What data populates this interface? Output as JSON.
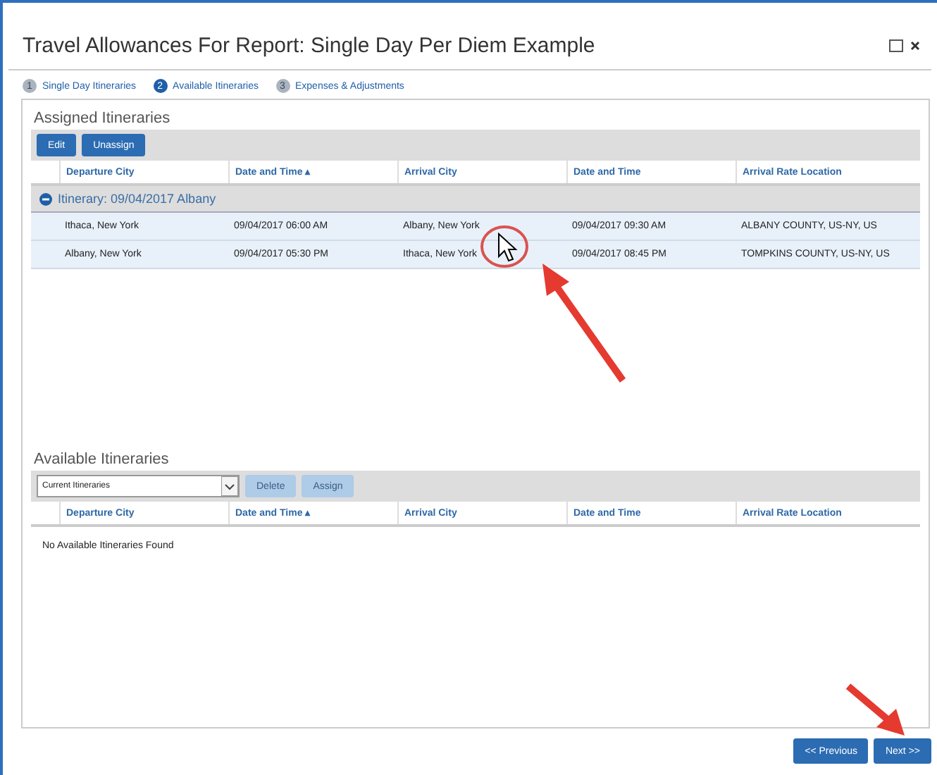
{
  "window": {
    "title": "Travel Allowances For Report: Single Day Per Diem Example"
  },
  "steps": [
    {
      "number": "1",
      "label": "Single Day Itineraries",
      "selected": false
    },
    {
      "number": "2",
      "label": "Available Itineraries",
      "selected": true
    },
    {
      "number": "3",
      "label": "Expenses & Adjustments",
      "selected": false
    }
  ],
  "assigned": {
    "title": "Assigned Itineraries",
    "buttons": [
      {
        "label": "Edit",
        "disabled": false
      },
      {
        "label": "Unassign",
        "disabled": false
      }
    ],
    "columns": [
      "Departure City",
      "Date and Time ▴",
      "Arrival City",
      "Date and Time",
      "Arrival Rate Location"
    ],
    "groups": [
      {
        "label": "Itinerary: 09/04/2017 Albany",
        "expanded": true,
        "rows": [
          [
            "Ithaca, New York",
            "09/04/2017 06:00 AM",
            "Albany, New York",
            "09/04/2017 09:30 AM",
            "ALBANY COUNTY, US-NY, US"
          ],
          [
            "Albany, New York",
            "09/04/2017 05:30 PM",
            "Ithaca, New York",
            "09/04/2017 08:45 PM",
            "TOMPKINS COUNTY, US-NY, US"
          ]
        ]
      }
    ]
  },
  "available": {
    "title": "Available Itineraries",
    "filter": {
      "value": "Current Itineraries"
    },
    "buttons": [
      {
        "label": "Delete",
        "disabled": true
      },
      {
        "label": "Assign",
        "disabled": true
      }
    ],
    "columns": [
      "Departure City",
      "Date and Time ▴",
      "Arrival City",
      "Date and Time",
      "Arrival Rate Location"
    ],
    "empty_message": "No Available Itineraries Found"
  },
  "footer": {
    "buttons": [
      "<< Previous",
      "Next >>"
    ]
  }
}
